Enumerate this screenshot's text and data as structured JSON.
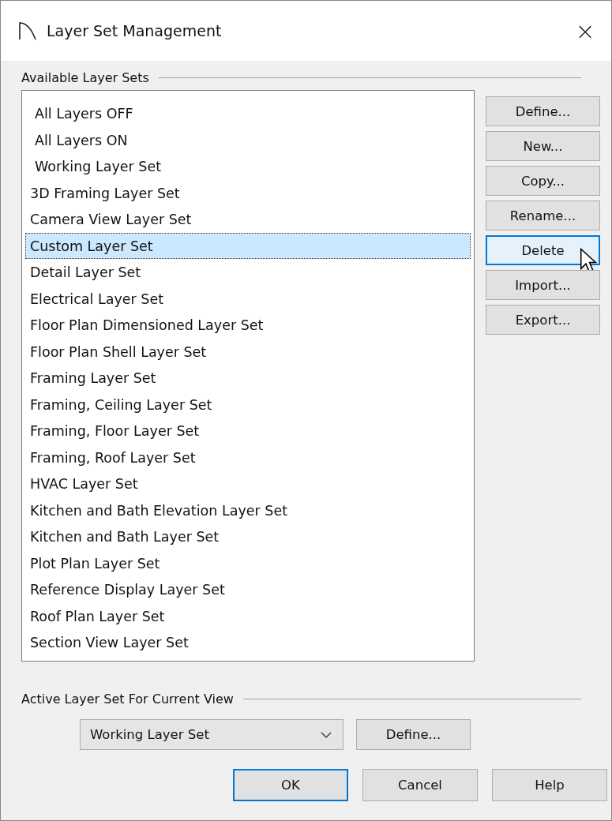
{
  "window": {
    "title": "Layer Set Management",
    "close": "×"
  },
  "available_group": {
    "label": "Available Layer Sets"
  },
  "layer_sets": [
    {
      "label": "All Layers OFF",
      "kind": "builtin",
      "selected": false
    },
    {
      "label": "All Layers ON",
      "kind": "builtin",
      "selected": false
    },
    {
      "label": "Working Layer Set",
      "kind": "builtin",
      "selected": false
    },
    {
      "label": "3D Framing Layer Set",
      "kind": "custom",
      "selected": false
    },
    {
      "label": "Camera View Layer Set",
      "kind": "custom",
      "selected": false
    },
    {
      "label": "Custom Layer Set",
      "kind": "custom",
      "selected": true
    },
    {
      "label": "Detail Layer Set",
      "kind": "custom",
      "selected": false
    },
    {
      "label": "Electrical Layer Set",
      "kind": "custom",
      "selected": false
    },
    {
      "label": "Floor Plan Dimensioned Layer Set",
      "kind": "custom",
      "selected": false
    },
    {
      "label": "Floor Plan Shell Layer Set",
      "kind": "custom",
      "selected": false
    },
    {
      "label": "Framing Layer Set",
      "kind": "custom",
      "selected": false
    },
    {
      "label": "Framing, Ceiling Layer Set",
      "kind": "custom",
      "selected": false
    },
    {
      "label": "Framing, Floor Layer Set",
      "kind": "custom",
      "selected": false
    },
    {
      "label": "Framing, Roof Layer Set",
      "kind": "custom",
      "selected": false
    },
    {
      "label": "HVAC Layer Set",
      "kind": "custom",
      "selected": false
    },
    {
      "label": "Kitchen and Bath Elevation Layer Set",
      "kind": "custom",
      "selected": false
    },
    {
      "label": "Kitchen and Bath Layer Set",
      "kind": "custom",
      "selected": false
    },
    {
      "label": "Plot Plan Layer Set",
      "kind": "custom",
      "selected": false
    },
    {
      "label": "Reference Display Layer Set",
      "kind": "custom",
      "selected": false
    },
    {
      "label": "Roof Plan Layer Set",
      "kind": "custom",
      "selected": false
    },
    {
      "label": "Section View Layer Set",
      "kind": "custom",
      "selected": false
    }
  ],
  "side_buttons": [
    {
      "label": "Define...",
      "hovered": false
    },
    {
      "label": "New...",
      "hovered": false
    },
    {
      "label": "Copy...",
      "hovered": false
    },
    {
      "label": "Rename...",
      "hovered": false
    },
    {
      "label": "Delete",
      "hovered": true
    },
    {
      "label": "Import...",
      "hovered": false
    },
    {
      "label": "Export...",
      "hovered": false
    }
  ],
  "active_group": {
    "label": "Active Layer Set For Current View",
    "dropdown": {
      "value": "Working Layer Set"
    },
    "define_button": "Define..."
  },
  "footer_buttons": [
    {
      "label": "OK",
      "default": true
    },
    {
      "label": "Cancel",
      "default": false
    },
    {
      "label": "Help",
      "default": false
    }
  ]
}
